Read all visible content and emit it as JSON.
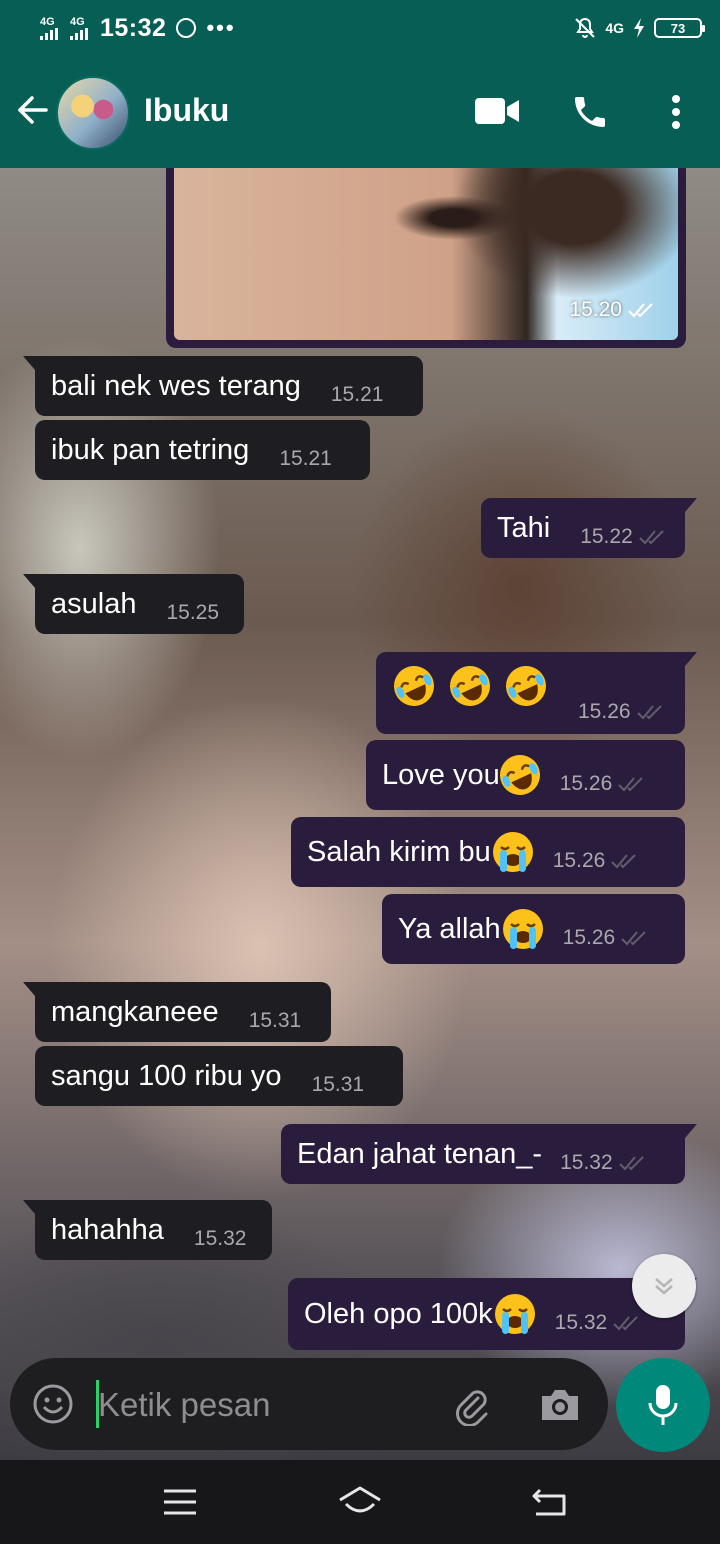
{
  "status_bar": {
    "network_1": "4G",
    "network_2": "4G",
    "time": "15:32",
    "right_network": "4G",
    "battery": "73",
    "more_indicator": "•••"
  },
  "header": {
    "contact_name": "Ibuku",
    "icons": [
      "back-arrow-icon",
      "video-call-icon",
      "phone-call-icon",
      "overflow-menu-icon"
    ]
  },
  "messages": [
    {
      "type": "image",
      "direction": "out",
      "time": "15.20",
      "status": "read"
    },
    {
      "type": "text",
      "direction": "in",
      "text": "bali nek wes terang",
      "time": "15.21"
    },
    {
      "type": "text",
      "direction": "in",
      "text": "ibuk pan tetring",
      "time": "15.21"
    },
    {
      "type": "text",
      "direction": "out",
      "text": "Tahi",
      "time": "15.22",
      "status": "delivered"
    },
    {
      "type": "text",
      "direction": "in",
      "text": "asulah",
      "time": "15.25"
    },
    {
      "type": "text",
      "direction": "out",
      "text": "",
      "emojis": [
        "rolling-laughing",
        "rolling-laughing",
        "rolling-laughing"
      ],
      "time": "15.26",
      "status": "delivered"
    },
    {
      "type": "text",
      "direction": "out",
      "text": "Love you",
      "emojis": [
        "rolling-laughing"
      ],
      "time": "15.26",
      "status": "delivered"
    },
    {
      "type": "text",
      "direction": "out",
      "text": "Salah kirim bu",
      "emojis": [
        "loudly-crying"
      ],
      "time": "15.26",
      "status": "delivered"
    },
    {
      "type": "text",
      "direction": "out",
      "text": "Ya allah",
      "emojis": [
        "loudly-crying"
      ],
      "time": "15.26",
      "status": "delivered"
    },
    {
      "type": "text",
      "direction": "in",
      "text": "mangkaneee",
      "time": "15.31"
    },
    {
      "type": "text",
      "direction": "in",
      "text": "sangu 100 ribu yo",
      "time": "15.31"
    },
    {
      "type": "text",
      "direction": "out",
      "text": "Edan jahat tenan_-",
      "time": "15.32",
      "status": "delivered"
    },
    {
      "type": "text",
      "direction": "in",
      "text": "hahahha",
      "time": "15.32"
    },
    {
      "type": "text",
      "direction": "out",
      "text": "Oleh opo 100k",
      "emojis": [
        "loudly-crying"
      ],
      "time": "15.32",
      "status": "delivered"
    }
  ],
  "composer": {
    "placeholder": "Ketik pesan",
    "value": "",
    "icons": [
      "emoji-icon",
      "attach-icon",
      "camera-icon",
      "mic-icon"
    ]
  },
  "colors": {
    "app_bar": "#075e54",
    "outgoing_bubble": "#2a1c3c",
    "incoming_bubble": "#1e1e22",
    "mic_button": "#00897b",
    "caret": "#25d366"
  }
}
